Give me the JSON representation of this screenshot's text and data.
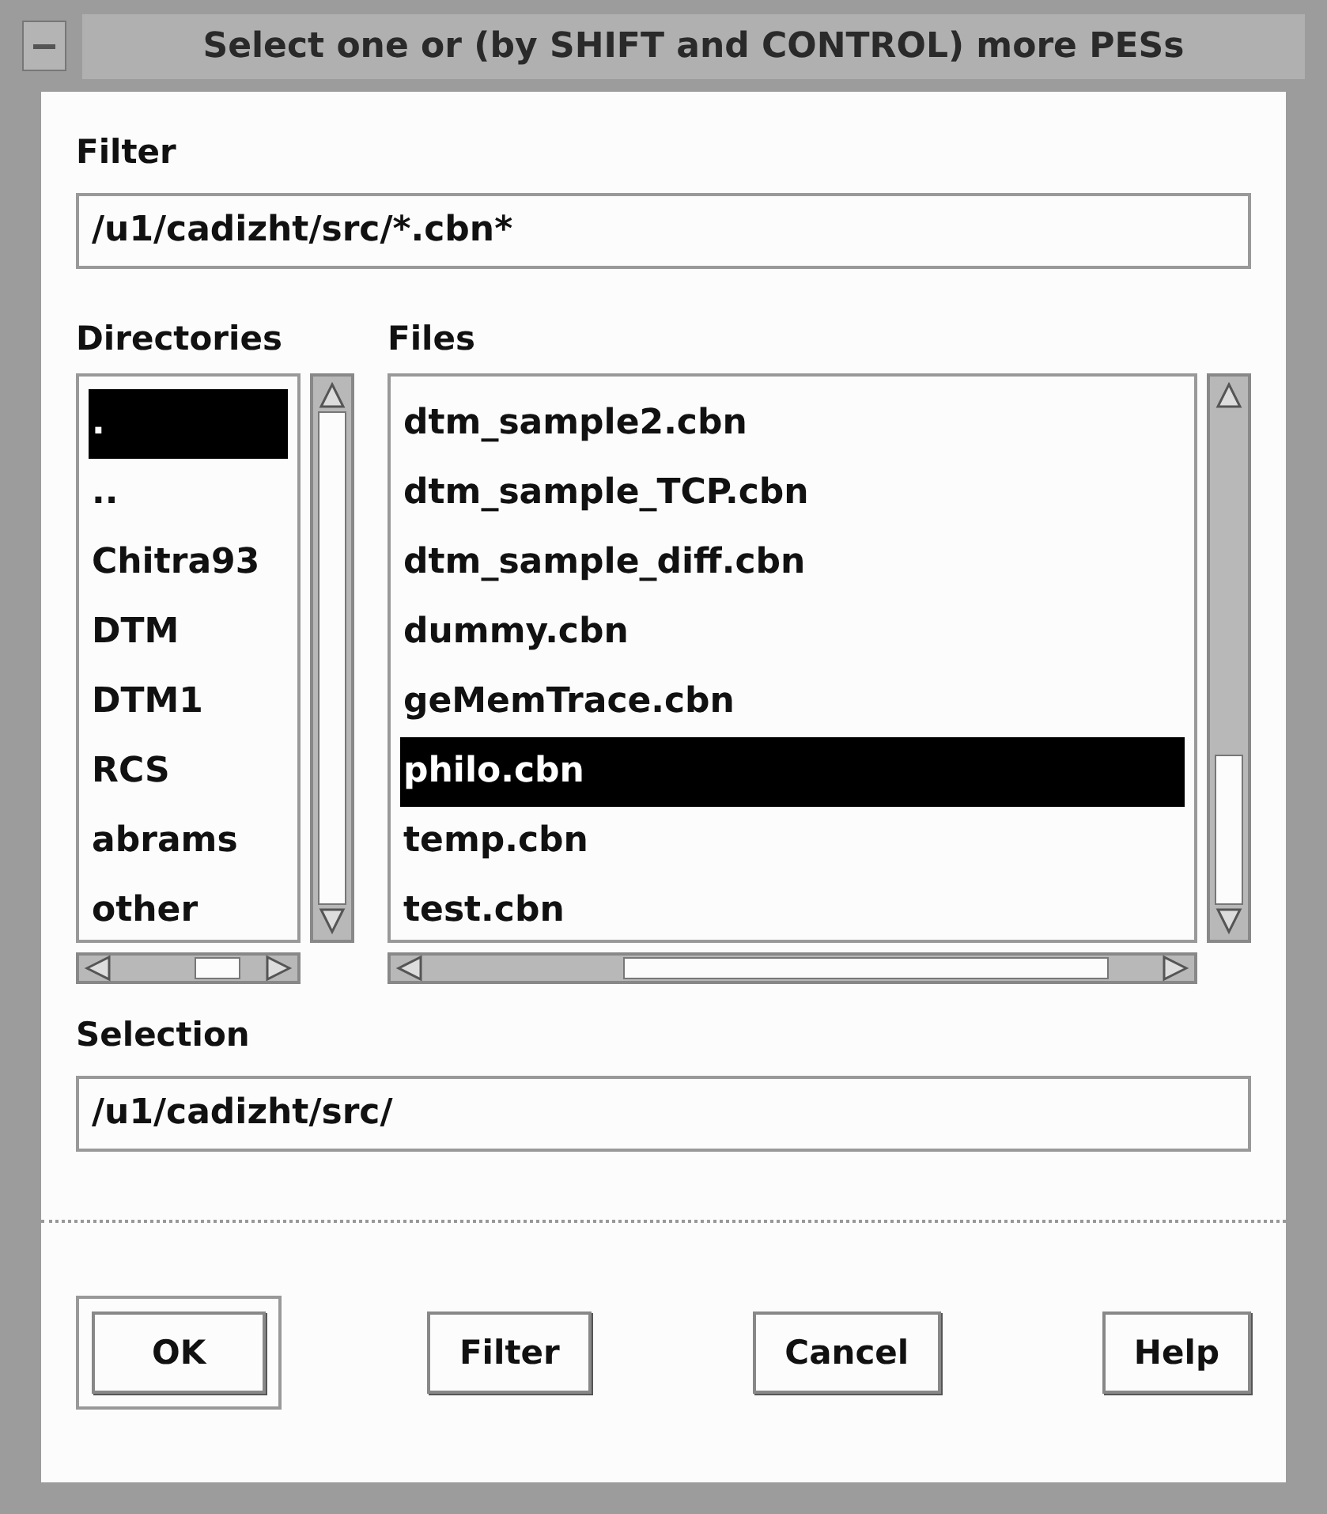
{
  "window": {
    "title": "Select one or (by SHIFT and CONTROL) more PESs"
  },
  "filter": {
    "label": "Filter",
    "value": "/u1/cadizht/src/*.cbn*"
  },
  "directories": {
    "label": "Directories",
    "items": [
      {
        "name": ".",
        "selected": true
      },
      {
        "name": "..",
        "selected": false
      },
      {
        "name": "Chitra93",
        "selected": false
      },
      {
        "name": "DTM",
        "selected": false
      },
      {
        "name": "DTM1",
        "selected": false
      },
      {
        "name": "RCS",
        "selected": false
      },
      {
        "name": "abrams",
        "selected": false
      },
      {
        "name": "other",
        "selected": false
      }
    ]
  },
  "files": {
    "label": "Files",
    "items": [
      {
        "name": "dtm_sample2.cbn",
        "selected": false
      },
      {
        "name": "dtm_sample_TCP.cbn",
        "selected": false
      },
      {
        "name": "dtm_sample_diff.cbn",
        "selected": false
      },
      {
        "name": "dummy.cbn",
        "selected": false
      },
      {
        "name": "geMemTrace.cbn",
        "selected": false
      },
      {
        "name": "philo.cbn",
        "selected": true
      },
      {
        "name": "temp.cbn",
        "selected": false
      },
      {
        "name": "test.cbn",
        "selected": false
      }
    ]
  },
  "selection": {
    "label": "Selection",
    "value": "/u1/cadizht/src/"
  },
  "buttons": [
    {
      "label": "OK",
      "default": true
    },
    {
      "label": "Filter",
      "default": false
    },
    {
      "label": "Cancel",
      "default": false
    },
    {
      "label": "Help",
      "default": false
    }
  ]
}
